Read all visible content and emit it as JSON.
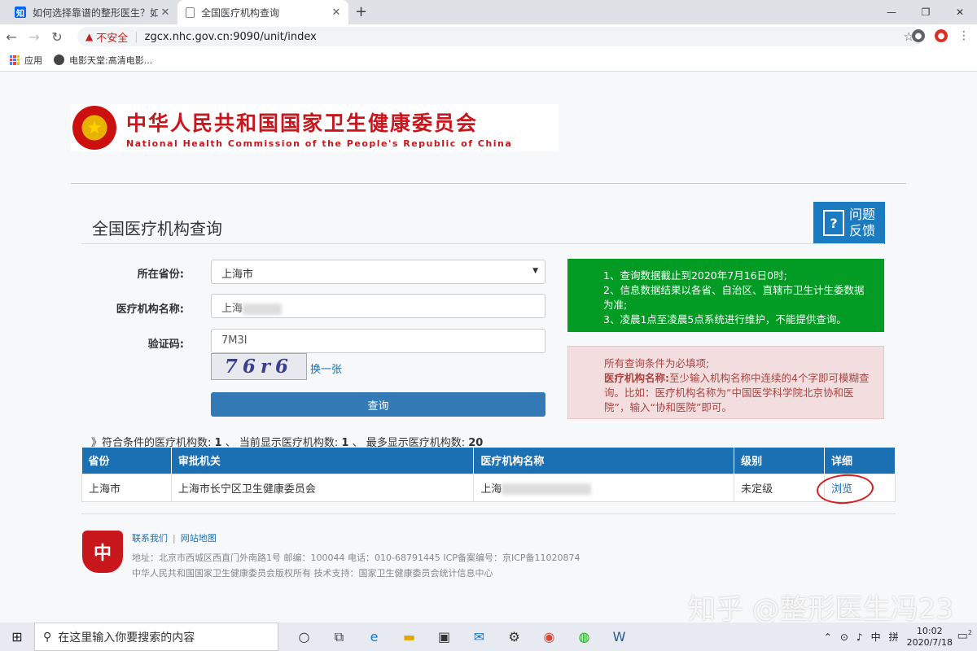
{
  "browser": {
    "tabs": [
      {
        "favicon": "知",
        "title": "如何选择靠谱的整形医生？如何...",
        "active": false
      },
      {
        "favicon": "",
        "title": "全国医疗机构查询",
        "active": true
      }
    ],
    "insecure_label": "不安全",
    "url": "zgcx.nhc.gov.cn:9090/unit/index",
    "bookmarks": [
      {
        "icon": "apps-grid-icon",
        "label": "应用"
      },
      {
        "icon": "site-icon",
        "label": "电影天堂:高清电影..."
      }
    ]
  },
  "header": {
    "org_name_cn": "中华人民共和国国家卫生健康委员会",
    "org_name_en": "National Health Commission of the People's Republic of China"
  },
  "page_title": "全国医疗机构查询",
  "feedback": {
    "line1": "问题",
    "line2": "反馈"
  },
  "form": {
    "province_label": "所在省份:",
    "province_value": "上海市",
    "name_label": "医疗机构名称:",
    "name_value": "上海",
    "captcha_label": "验证码:",
    "captcha_value": "7M3I",
    "captcha_image_text": "76r6",
    "refresh_label": "换一张",
    "submit_label": "查询"
  },
  "notes": {
    "green": [
      "1、查询数据截止到2020年7月16日0时;",
      "2、信息数据结果以各省、自治区、直辖市卫生计生委数据为准;",
      "3、凌晨1点至凌晨5点系统进行维护，不能提供查询。"
    ],
    "red_intro": "所有查询条件为必填项;",
    "red_bold": "医疗机构名称:",
    "red_text": "至少输入机构名称中连续的4个字即可模糊查询。比如：医疗机构名称为“中国医学科学院北京协和医院”，输入“协和医院”即可。"
  },
  "stats": {
    "prefix": "》符合条件的医疗机构数:",
    "matched": "1",
    "mid": "、 当前显示医疗机构数:",
    "shown": "1",
    "mid2": "、 最多显示医疗机构数:",
    "max": "20"
  },
  "table": {
    "headers": [
      "省份",
      "审批机关",
      "医疗机构名称",
      "级别",
      "详细"
    ],
    "rows": [
      {
        "province": "上海市",
        "authority": "上海市长宁区卫生健康委员会",
        "name": "上海",
        "level": "未定级",
        "detail": "浏览"
      }
    ]
  },
  "footer": {
    "emblem": "中",
    "link1": "联系我们",
    "link2": "网站地图",
    "address": "地址：北京市西城区西直门外南路1号    邮编：100044    电话：010-68791445    ICP备案编号：京ICP备11020874",
    "copyright": "中华人民共和国国家卫生健康委员会版权所有    技术支持：国家卫生健康委员会统计信息中心"
  },
  "watermark": "知乎 @整形医生冯23",
  "taskbar": {
    "search_placeholder": "在这里输入你要搜索的内容",
    "ime": "中",
    "ime2": "拼",
    "time": "10:02",
    "date": "2020/7/18",
    "notif_count": "2"
  }
}
